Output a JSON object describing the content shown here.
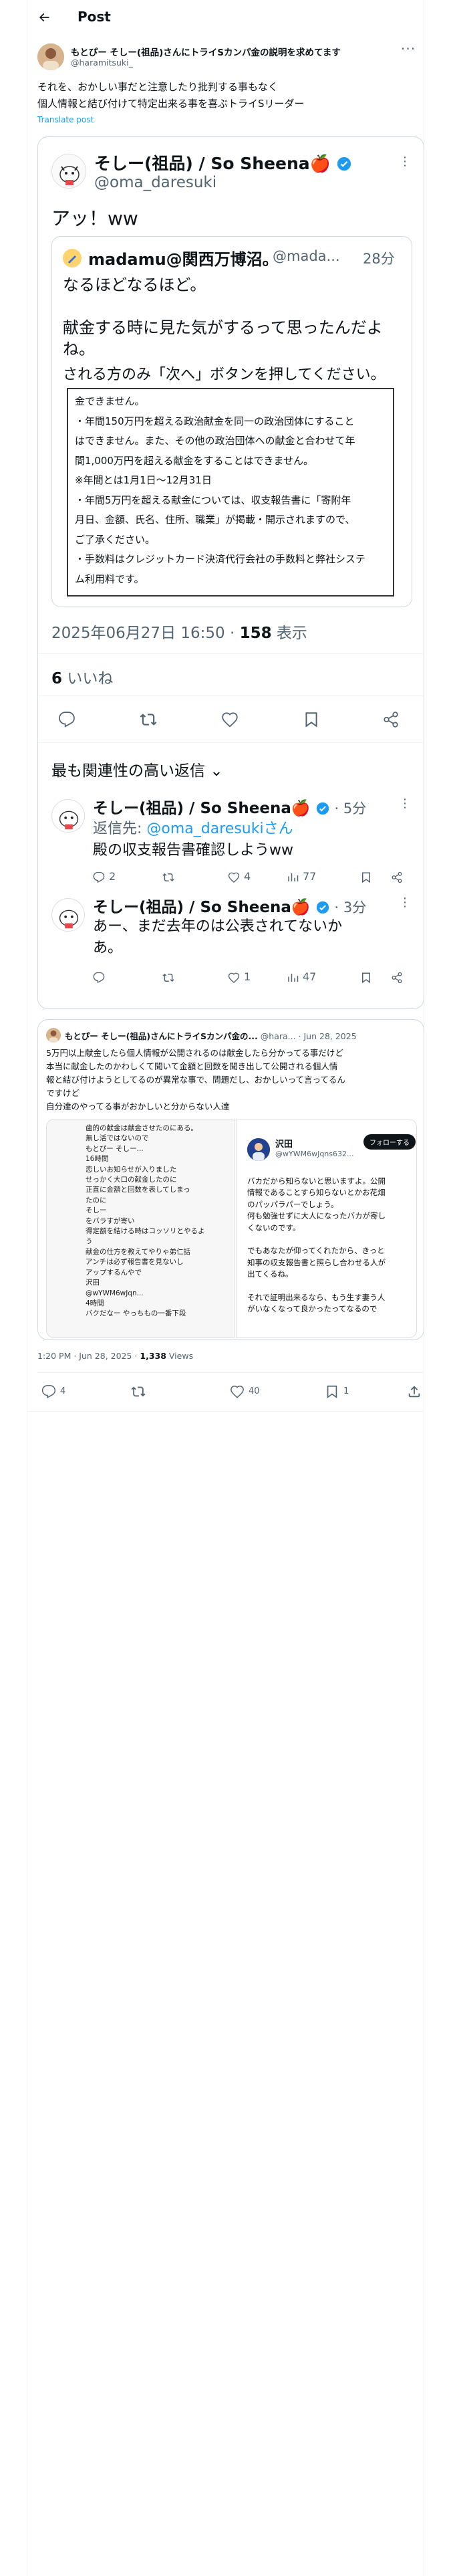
{
  "header": {
    "back_icon": "arrow-left-icon",
    "title": "Post"
  },
  "main_post": {
    "author_name": "もとぴー そしー(祖品)さんにトライSカンパ金の説明を求めてます",
    "author_handle": "@haramitsuki_",
    "text_line1": "それを、おかしい事だと注意したり批判する事もなく",
    "text_line2": "個人情報と結び付けて特定出来る事を喜ぶトライSリーダー",
    "translate": "Translate post",
    "timestamp": "1:20 PM · Jun 28, 2025 · ",
    "views_count": "1,338",
    "views_label": " Views",
    "actions": {
      "replies": "4",
      "reposts": "",
      "likes": "40",
      "bookmarks": "1"
    }
  },
  "embedded_screenshot": {
    "post": {
      "author_name": "そしー(祖品) / So Sheena🍎",
      "author_handle": "@oma_daresuki",
      "text": "アッ！ww",
      "quote": {
        "author": "madamu@関西万博沼。",
        "handle": "@mada...",
        "time": "28分",
        "line1": "なるほどなるほど。",
        "line2": "献金する時に見た気がするって思ったんだよ",
        "line3": "ね。",
        "line4": "される方のみ「次へ」ボタンを押してください。",
        "notice": [
          "金できません。",
          "・年間150万円を超える政治献金を同一の政治団体にすること",
          "はできません。また、その他の政治団体への献金と合わせて年",
          "間1,000万円を超える献金をすることはできません。",
          "※年間とは1月1日〜12月31日",
          "・年間5万円を超える献金については、収支報告書に「寄附年",
          "月日、金額、氏名、住所、職業」が掲載・開示されますので、",
          "ご了承ください。",
          "・手数料はクレジットカード決済代行会社の手数料と弊社システ",
          "ム利用料です。"
        ]
      },
      "timestamp": "2025年06月27日 16:50 · ",
      "views_count": "158",
      "views_label": " 表示",
      "likes_count": "6",
      "likes_label": " いいね"
    },
    "replies_header": "最も関連性の高い返信",
    "replies": [
      {
        "author": "そしー(祖品) / So Sheena🍎",
        "time": "5分",
        "reply_to_prefix": "返信先: ",
        "reply_to_handle": "@oma_daresukiさん",
        "text": "殿の収支報告書確認しようww",
        "replies": "2",
        "likes": "4",
        "views": "77"
      },
      {
        "author": "そしー(祖品) / So Sheena🍎",
        "time": "3分",
        "text_line1": "あー、まだ去年のは公表されてないか",
        "text_line2": "あ。",
        "likes": "1",
        "views": "47"
      }
    ]
  },
  "quoted_post": {
    "author_name": "もとぴー そしー(祖品)さんにトライSカンパ金の...",
    "author_handle": "@hara...",
    "date": "Jun 28, 2025",
    "text": [
      "5万円以上献金したら個人情報が公開されるのは献金したら分かってる事だけど",
      "本当に献金したのかわしくて聞いて金額と回数を聞き出して公開される個人情",
      "報と結び付けようとしてるのが異常な事で、問題だし、おかしいって言ってるん",
      "ですけど",
      "自分達のやってる事がおかしいと分からない人達"
    ],
    "left_shot": [
      "歯的の献金は献金させたのにある。",
      "無し活ではないので",
      "もとぴー そしー...",
      "16時間",
      "恋しいお知らせが入りました",
      "せっかく大口の献金したのに",
      "正直に金額と回数を表してしまっ",
      "たのに",
      "そしー",
      "をバラすが寄い",
      "得定額を結ける時はコッソリとやるよ",
      "う",
      "献金の仕方を教えてやりゃ弟仁話",
      "アンチは必ず報告書を見ないし",
      "アップするんやで",
      "沢田",
      "@wYWM6wJqn...",
      "4時間",
      "バクだなー やっちもの一番下段"
    ],
    "right_shot": {
      "author": "沢田",
      "handle": "@wYWM6wJqns632...",
      "follow": "フォローする",
      "lines": [
        "バカだから知らないと思いますよ。公開",
        "情報であることすら知らないとかお花畑",
        "のパッパラパーでしょう。",
        "何も勉強せずに大人になったバカが寄し",
        "くないのです。",
        "",
        "でもあなたが仰ってくれたから、きっと",
        "知事の収支報告書と照らし合わせる人が",
        "出てくるね。",
        "",
        "それで証明出来るなら、もう生す妻う人",
        "がいなくなって良かったってなるので"
      ]
    }
  }
}
